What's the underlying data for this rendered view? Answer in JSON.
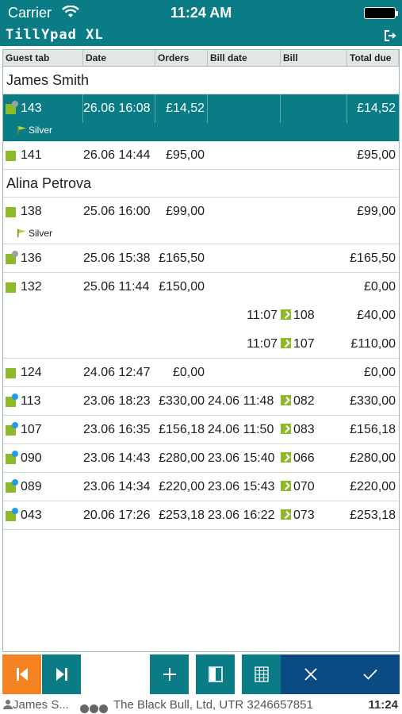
{
  "status_bar": {
    "carrier": "Carrier",
    "time": "11:24 AM"
  },
  "app": {
    "logo": "TillYpad XL",
    "logout_icon": "logout-icon"
  },
  "table": {
    "columns": [
      "Guest tab",
      "Date",
      "Orders",
      "Bill date",
      "Bill",
      "Total due"
    ],
    "groups": [
      {
        "guest": "James Smith",
        "tabs": [
          {
            "tab": "143",
            "date": "26.06 16:08",
            "orders": "£14,52",
            "bill_date": "",
            "bill": "",
            "total": "£14,52",
            "tier": "Silver",
            "selected": true,
            "badge": "grey"
          },
          {
            "tab": "141",
            "date": "26.06 14:44",
            "orders": "£95,00",
            "bill_date": "",
            "bill": "",
            "total": "£95,00",
            "tier": "",
            "selected": false,
            "badge": ""
          }
        ]
      },
      {
        "guest": "Alina Petrova",
        "tabs": [
          {
            "tab": "138",
            "date": "25.06 16:00",
            "orders": "£99,00",
            "bill_date": "",
            "bill": "",
            "total": "£99,00",
            "tier": "Silver",
            "selected": false,
            "badge": ""
          },
          {
            "tab": "136",
            "date": "25.06 15:38",
            "orders": "£165,50",
            "bill_date": "",
            "bill": "",
            "total": "£165,50",
            "tier": "",
            "selected": false,
            "badge": "grey"
          },
          {
            "tab": "132",
            "date": "25.06 11:44",
            "orders": "£150,00",
            "bill_date": "",
            "bill": "",
            "total": "£0,00",
            "tier": "",
            "selected": false,
            "badge": "",
            "bills": [
              {
                "bill_date": "11:07",
                "bill": "108",
                "total": "£40,00"
              },
              {
                "bill_date": "11:07",
                "bill": "107",
                "total": "£110,00"
              }
            ]
          },
          {
            "tab": "124",
            "date": "24.06 12:47",
            "orders": "£0,00",
            "bill_date": "",
            "bill": "",
            "total": "£0,00",
            "tier": "",
            "selected": false,
            "badge": ""
          },
          {
            "tab": "113",
            "date": "23.06 18:23",
            "orders": "£330,00",
            "bill_date": "24.06 11:48",
            "bill": "082",
            "total": "£330,00",
            "tier": "",
            "selected": false,
            "badge": "blue"
          },
          {
            "tab": "107",
            "date": "23.06 16:35",
            "orders": "£156,18",
            "bill_date": "24.06 11:50",
            "bill": "083",
            "total": "£156,18",
            "tier": "",
            "selected": false,
            "badge": "blue"
          },
          {
            "tab": "090",
            "date": "23.06 14:43",
            "orders": "£280,00",
            "bill_date": "23.06 15:40",
            "bill": "066",
            "total": "£280,00",
            "tier": "",
            "selected": false,
            "badge": "blue"
          },
          {
            "tab": "089",
            "date": "23.06 14:34",
            "orders": "£220,00",
            "bill_date": "23.06 15:43",
            "bill": "070",
            "total": "£220,00",
            "tier": "",
            "selected": false,
            "badge": "blue"
          },
          {
            "tab": "043",
            "date": "20.06 17:26",
            "orders": "£253,18",
            "bill_date": "23.06 16:22",
            "bill": "073",
            "total": "£253,18",
            "tier": "",
            "selected": false,
            "badge": "blue"
          }
        ]
      }
    ]
  },
  "toolbar": {
    "buttons": [
      {
        "name": "first-page-button",
        "icon": "skip-back-icon",
        "color": "#f58220"
      },
      {
        "name": "next-page-button",
        "icon": "skip-forward-icon",
        "color": "#0a7c86"
      },
      {
        "name": "add-button",
        "icon": "plus-icon",
        "color": "#0a7c86"
      },
      {
        "name": "details-button",
        "icon": "panel-icon",
        "color": "#0a7c86"
      },
      {
        "name": "grid-button",
        "icon": "grid-icon",
        "color": "#0a7c86"
      },
      {
        "name": "cancel-button",
        "icon": "close-icon",
        "color": "#0b4b84"
      },
      {
        "name": "confirm-button",
        "icon": "check-icon",
        "color": "#0b4b84"
      }
    ]
  },
  "footer": {
    "user": "James S...",
    "venue": "The Black Bull, Ltd, UTR 3246657851",
    "time": "11:24"
  },
  "colors": {
    "primary": "#0a7c86",
    "accent": "#f58220",
    "navy": "#0b4b84",
    "tab_icon": "#8dba2a",
    "badge_blue": "#1f9be8",
    "badge_grey": "#9aa0a3"
  }
}
